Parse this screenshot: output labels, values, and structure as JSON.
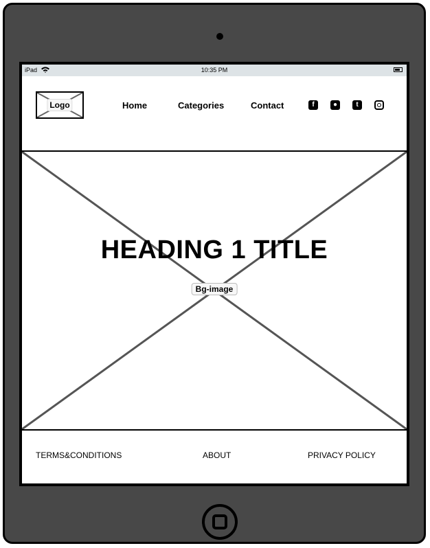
{
  "statusbar": {
    "carrier": "iPad",
    "time": "10:35 PM"
  },
  "header": {
    "logo_label": "Logo",
    "nav": {
      "home": "Home",
      "categories": "Categories",
      "contact": "Contact"
    },
    "social_icons": [
      "facebook-icon",
      "github-icon",
      "twitter-icon",
      "instagram-icon"
    ]
  },
  "hero": {
    "title": "HEADING 1 TITLE",
    "image_label": "Bg-image"
  },
  "footer": {
    "terms": "TERMS&CONDITIONS",
    "about": "ABOUT",
    "privacy": "PRIVACY POLICY"
  }
}
